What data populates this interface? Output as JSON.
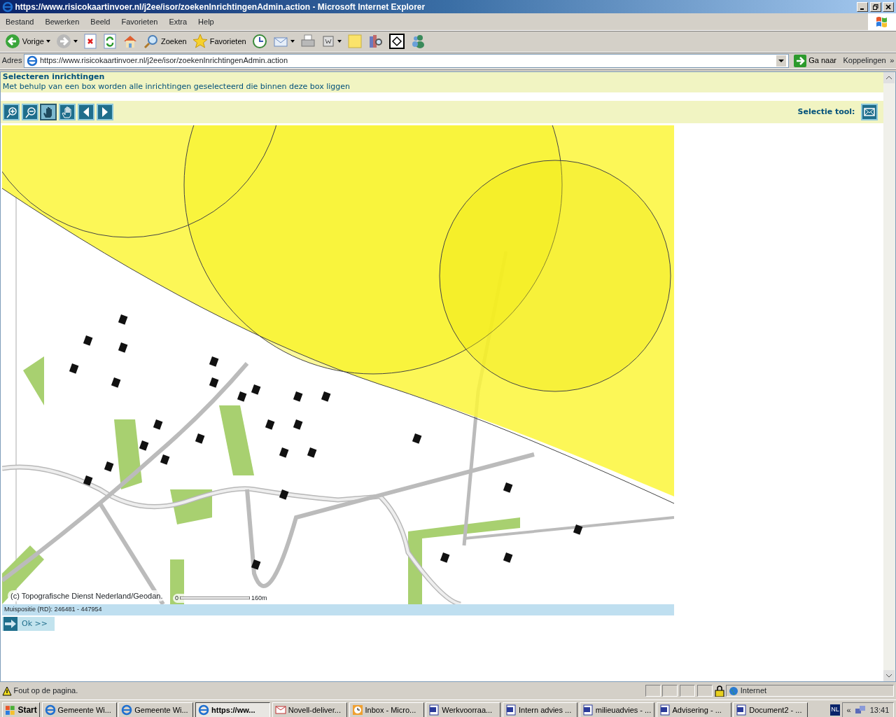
{
  "window": {
    "title": "https://www.risicokaartinvoer.nl/j2ee/isor/zoekenInrichtingenAdmin.action - Microsoft Internet Explorer"
  },
  "menu": [
    "Bestand",
    "Bewerken",
    "Beeld",
    "Favorieten",
    "Extra",
    "Help"
  ],
  "toolbar": {
    "back": "Vorige",
    "search": "Zoeken",
    "favorites": "Favorieten"
  },
  "address": {
    "label": "Adres",
    "value": "https://www.risicokaartinvoer.nl/j2ee/isor/zoekenInrichtingenAdmin.action",
    "go": "Ga naar",
    "links": "Koppelingen",
    "more": "»"
  },
  "page": {
    "heading": "Selecteren inrichtingen",
    "description": "Met behulp van een box worden alle inrichtingen geselecteerd die binnen deze box liggen",
    "tools": [
      {
        "kind": "zoom-in",
        "selected": false
      },
      {
        "kind": "zoom-out",
        "selected": false
      },
      {
        "kind": "pan",
        "selected": true
      },
      {
        "kind": "identify",
        "selected": false
      },
      {
        "kind": "previous",
        "selected": false
      },
      {
        "kind": "next",
        "selected": false
      }
    ],
    "selection_label": "Selectie tool:",
    "map": {
      "copyright": "(c) Topografische Dienst Nederland/Geodan.",
      "scale_start": "0",
      "scale_end": "160m"
    },
    "mouse_position": "Muispositie (RD): 246481  -  447954",
    "ok_button": "Ok >>"
  },
  "status_bar": {
    "message": "Fout op de pagina.",
    "zone": "Internet"
  },
  "taskbar": {
    "start": "Start",
    "items": [
      {
        "kind": "ie",
        "label": "Gemeente Wi...",
        "selected": false
      },
      {
        "kind": "ie",
        "label": "Gemeente Wi...",
        "selected": false
      },
      {
        "kind": "ie",
        "label": "https://ww...",
        "selected": true
      },
      {
        "kind": "novell",
        "label": "Novell-deliver...",
        "selected": false
      },
      {
        "kind": "outlook",
        "label": "Inbox - Micro...",
        "selected": false
      },
      {
        "kind": "word",
        "label": "Werkvoorraa...",
        "selected": false
      },
      {
        "kind": "word",
        "label": "Intern advies ...",
        "selected": false
      },
      {
        "kind": "word",
        "label": "milieuadvies - ...",
        "selected": false
      },
      {
        "kind": "word",
        "label": "Advisering - ...",
        "selected": false
      },
      {
        "kind": "word",
        "label": "Document2 - ...",
        "selected": false
      }
    ],
    "language": "NL",
    "tray_expand": "«",
    "clock": "13:41"
  }
}
